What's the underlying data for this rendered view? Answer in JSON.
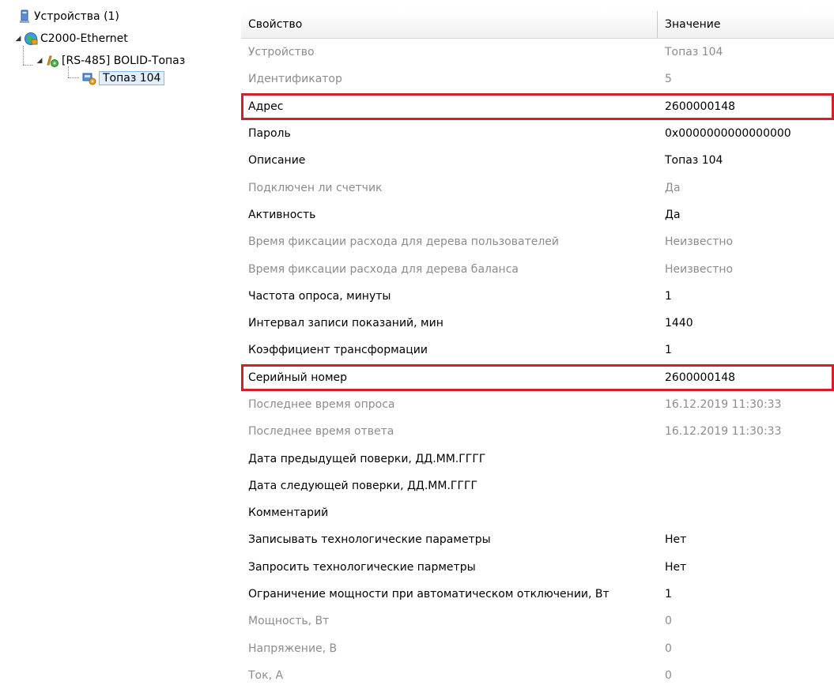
{
  "tree": {
    "root": {
      "label": "Устройства (1)",
      "icon": "devices-icon"
    },
    "nodes": [
      {
        "label": "C2000-Ethernet",
        "icon": "network-globe-icon"
      },
      {
        "label": "[RS-485] BOLID-Топаз",
        "icon": "rs485-interface-icon"
      },
      {
        "label": "Топаз 104",
        "icon": "meter-device-icon",
        "selected": true
      }
    ]
  },
  "grid": {
    "header": {
      "property": "Свойство",
      "value": "Значение"
    },
    "rows": [
      {
        "name": "Устройство",
        "value": "Топаз 104",
        "readonly": true
      },
      {
        "name": "Идентификатор",
        "value": "5",
        "readonly": true
      },
      {
        "name": "Адрес",
        "value": "2600000148",
        "highlight": true
      },
      {
        "name": "Пароль",
        "value": "0x0000000000000000"
      },
      {
        "name": "Описание",
        "value": "Топаз 104"
      },
      {
        "name": "Подключен ли счетчик",
        "value": "Да",
        "readonly": true
      },
      {
        "name": "Активность",
        "value": "Да"
      },
      {
        "name": "Время фиксации расхода для дерева пользователей",
        "value": "Неизвестно",
        "readonly": true
      },
      {
        "name": "Время фиксации расхода для дерева баланса",
        "value": "Неизвестно",
        "readonly": true
      },
      {
        "name": "Частота опроса, минуты",
        "value": "1"
      },
      {
        "name": "Интервал записи показаний, мин",
        "value": "1440"
      },
      {
        "name": "Коэффициент трансформации",
        "value": "1"
      },
      {
        "name": "Серийный номер",
        "value": "2600000148",
        "highlight": true
      },
      {
        "name": "Последнее время опроса",
        "value": "16.12.2019 11:30:33",
        "readonly": true
      },
      {
        "name": "Последнее время ответа",
        "value": "16.12.2019 11:30:33",
        "readonly": true
      },
      {
        "name": "Дата предыдущей поверки, ДД.ММ.ГГГГ",
        "value": ""
      },
      {
        "name": "Дата следующей поверки, ДД.ММ.ГГГГ",
        "value": ""
      },
      {
        "name": "Комментарий",
        "value": ""
      },
      {
        "name": "Записывать технологические параметры",
        "value": "Нет"
      },
      {
        "name": "Запросить технологические парметры",
        "value": "Нет"
      },
      {
        "name": "Ограничение мощности при автоматическом отключении, Вт",
        "value": "1"
      },
      {
        "name": "Мощность, Вт",
        "value": "0",
        "readonly": true
      },
      {
        "name": "Напряжение, В",
        "value": "0",
        "readonly": true
      },
      {
        "name": "Ток, А",
        "value": "0",
        "readonly": true
      }
    ]
  },
  "colors": {
    "highlight_border": "#d2202a",
    "readonly_text": "#8c8c8c",
    "selection_bg": "#e2eef9"
  }
}
